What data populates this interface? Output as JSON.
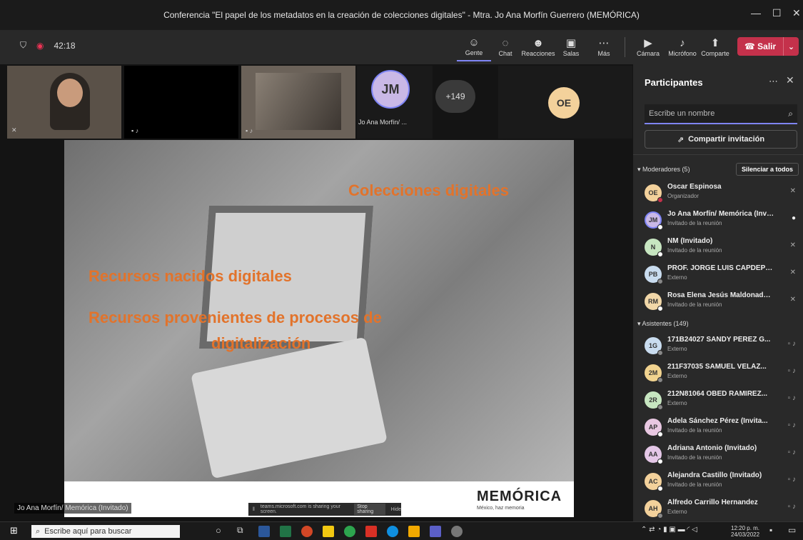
{
  "window": {
    "title": "Conferencia \"El papel de los metadatos en la creación de colecciones digitales\" - Mtra. Jo Ana Morfín Guerrero (MEMÓRICA)",
    "minimize": "—",
    "maximize": "☐",
    "close": "✕"
  },
  "toolbar": {
    "timer": "42:18",
    "buttons": [
      {
        "label": "Gente",
        "icon": "people-icon"
      },
      {
        "label": "Chat",
        "icon": "chat-icon"
      },
      {
        "label": "Reacciones",
        "icon": "reactions-icon"
      },
      {
        "label": "Salas",
        "icon": "rooms-icon"
      },
      {
        "label": "Más",
        "icon": "more-icon"
      },
      {
        "label": "Cámara",
        "icon": "camera-off-icon"
      },
      {
        "label": "Micrófono",
        "icon": "mic-off-icon"
      },
      {
        "label": "Comparte",
        "icon": "share-icon"
      }
    ],
    "leave_label": "Salir"
  },
  "video_tiles": {
    "jm_initials": "JM",
    "jm_name": "Jo Ana Morfín/ ...",
    "overflow": "+149",
    "oe_initials": "OE"
  },
  "slide": {
    "line1": "Colecciones digitales",
    "line2": "Recursos nacidos digitales",
    "line3": "Recursos provenientes de procesos de",
    "line4": "digitalización",
    "brand": "MEMÓRICA",
    "tagline": "México, haz memoria"
  },
  "presenter_caption": "Jo Ana Morfín/ Memórica (Invitado)",
  "share_bar": {
    "text": "teams.microsoft.com is sharing your screen.",
    "stop": "Stop sharing",
    "hide": "Hide"
  },
  "panel": {
    "title": "Participantes",
    "search_placeholder": "Escribe un nombre",
    "invite_label": "Compartir invitación",
    "moderators_header": "Moderadores (5)",
    "mute_all": "Silenciar a todos",
    "attendees_header": "Asistentes (149)",
    "moderators": [
      {
        "initials": "OE",
        "name": "Oscar Espinosa",
        "role": "Organizador",
        "color": "#f3d19b"
      },
      {
        "initials": "JM",
        "name": "Jo Ana Morfín/ Memórica (Invit...",
        "role": "Invitado de la reunión",
        "color": "#c9b8e6"
      },
      {
        "initials": "N",
        "name": "NM (Invitado)",
        "role": "Invitado de la reunión",
        "color": "#c7e6c1"
      },
      {
        "initials": "PB",
        "name": "PROF. JORGE LUIS CAPDEPONT ...",
        "role": "Externo",
        "color": "#c9dcef"
      },
      {
        "initials": "RM",
        "name": "Rosa Elena Jesús Maldonado (In...",
        "role": "Invitado de la reunión",
        "color": "#f1d7a8"
      }
    ],
    "attendees": [
      {
        "initials": "1G",
        "name": "171B24027 SANDY PÉREZ G...",
        "role": "Externo",
        "color": "#c9dcef"
      },
      {
        "initials": "2M",
        "name": "211F37035 SAMUEL VELÁZ...",
        "role": "Externo",
        "color": "#f1d38f"
      },
      {
        "initials": "2R",
        "name": "212N81064 OBED RAMIREZ...",
        "role": "Externo",
        "color": "#c7e6c1"
      },
      {
        "initials": "AP",
        "name": "Adela Sánchez Pérez (Invita...",
        "role": "Invitado de la reunión",
        "color": "#e9c8e2"
      },
      {
        "initials": "AA",
        "name": "Adriana Antonio (Invitado)",
        "role": "Invitado de la reunión",
        "color": "#e4c7e7"
      },
      {
        "initials": "AC",
        "name": "Alejandra Castillo (Invitado)",
        "role": "Invitado de la reunión",
        "color": "#f3d19b"
      },
      {
        "initials": "AH",
        "name": "Alfredo Carrillo Hernandez",
        "role": "Externo",
        "color": "#f3d19b"
      }
    ]
  },
  "taskbar": {
    "search_placeholder": "Escribe aquí para buscar",
    "time": "12:20 p. m.",
    "date": "24/03/2022"
  }
}
